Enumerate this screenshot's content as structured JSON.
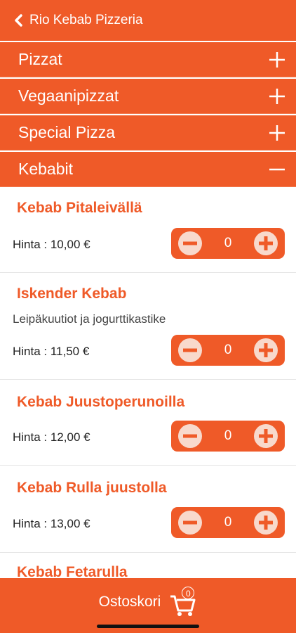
{
  "header": {
    "title": "Rio Kebab Pizzeria",
    "back_icon": "chevron-left-icon"
  },
  "categories": [
    {
      "label": "Pizzat",
      "icon": "plus-icon"
    },
    {
      "label": "Vegaanipizzat",
      "icon": "plus-icon"
    },
    {
      "label": "Special Pizza",
      "icon": "plus-icon"
    },
    {
      "label": "Kebabit",
      "icon": "minus-icon"
    }
  ],
  "items": [
    {
      "name": "Kebab Pitaleivällä",
      "description": "",
      "price": "Hinta : 10,00 €",
      "quantity": "0"
    },
    {
      "name": "Iskender Kebab",
      "description": "Leipäkuutiot ja jogurttikastike",
      "price": "Hinta : 11,50 €",
      "quantity": "0"
    },
    {
      "name": "Kebab Juustoperunoilla",
      "description": "",
      "price": "Hinta : 12,00 €",
      "quantity": "0"
    },
    {
      "name": "Kebab Rulla juustolla",
      "description": "",
      "price": "Hinta : 13,00 €",
      "quantity": "0"
    },
    {
      "name": "Kebab Fetarulla"
    }
  ],
  "cart": {
    "label": "Ostoskori",
    "count": "0",
    "icon": "cart-icon"
  },
  "colors": {
    "accent": "#ef5a28",
    "stepper_button": "#f8d9cc"
  }
}
